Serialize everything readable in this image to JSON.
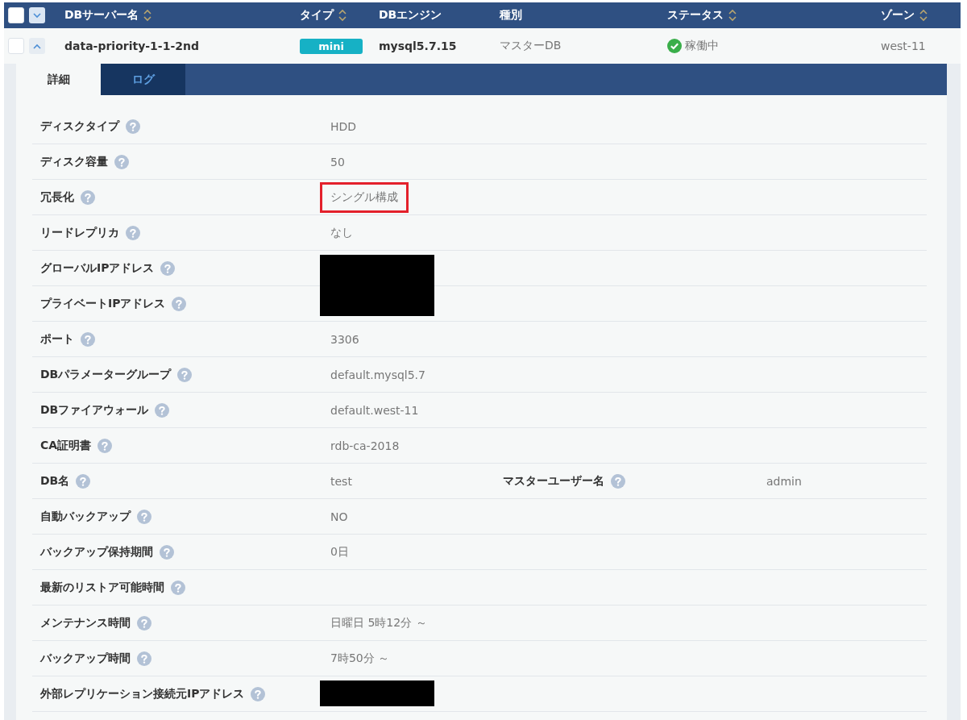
{
  "table": {
    "header_checkbox": {
      "checked": false
    },
    "columns": [
      {
        "label": "DBサーバー名",
        "sortable": true
      },
      {
        "label": "タイプ",
        "sortable": true
      },
      {
        "label": "DBエンジン",
        "sortable": false
      },
      {
        "label": "種別",
        "sortable": false
      },
      {
        "label": "ステータス",
        "sortable": true
      },
      {
        "label": "ゾーン",
        "sortable": true
      }
    ],
    "row": {
      "checked": false,
      "expanded": true,
      "name": "data-priority-1-1-2nd",
      "type": "mini",
      "engine": "mysql5.7.15",
      "kind": "マスターDB",
      "status": "稼働中",
      "zone": "west-11"
    }
  },
  "detail": {
    "tabs": [
      {
        "label": "詳細",
        "selected": true
      },
      {
        "label": "ログ",
        "selected": false
      }
    ],
    "rows": [
      {
        "label": "ディスクタイプ",
        "value": "HDD"
      },
      {
        "label": "ディスク容量",
        "value": "50"
      },
      {
        "label": "冗長化",
        "value": "シングル構成",
        "highlighted": true
      },
      {
        "label": "リードレプリカ",
        "value": "なし"
      },
      {
        "label": "グローバルIPアドレス",
        "redacted": true
      },
      {
        "label": "プライベートIPアドレス",
        "redacted": true
      },
      {
        "label": "ポート",
        "value": "3306"
      },
      {
        "label": "DBパラメーターグループ",
        "value": "default.mysql5.7"
      },
      {
        "label": "DBファイアウォール",
        "value": "default.west-11"
      },
      {
        "label": "CA証明書",
        "value": "rdb-ca-2018"
      },
      {
        "label": "DB名",
        "value": "test",
        "extra": {
          "label": "マスターユーザー名",
          "value": "admin"
        }
      },
      {
        "label": "自動バックアップ",
        "value": "NO"
      },
      {
        "label": "バックアップ保持期間",
        "value": "0日"
      },
      {
        "label": "最新のリストア可能時間"
      },
      {
        "label": "メンテナンス時間",
        "value": "日曜日 5時12分 ～"
      },
      {
        "label": "バックアップ時間",
        "value": "7時50分 ～"
      },
      {
        "label": "外部レプリケーション接続元IPアドレス",
        "redacted": true
      }
    ]
  }
}
